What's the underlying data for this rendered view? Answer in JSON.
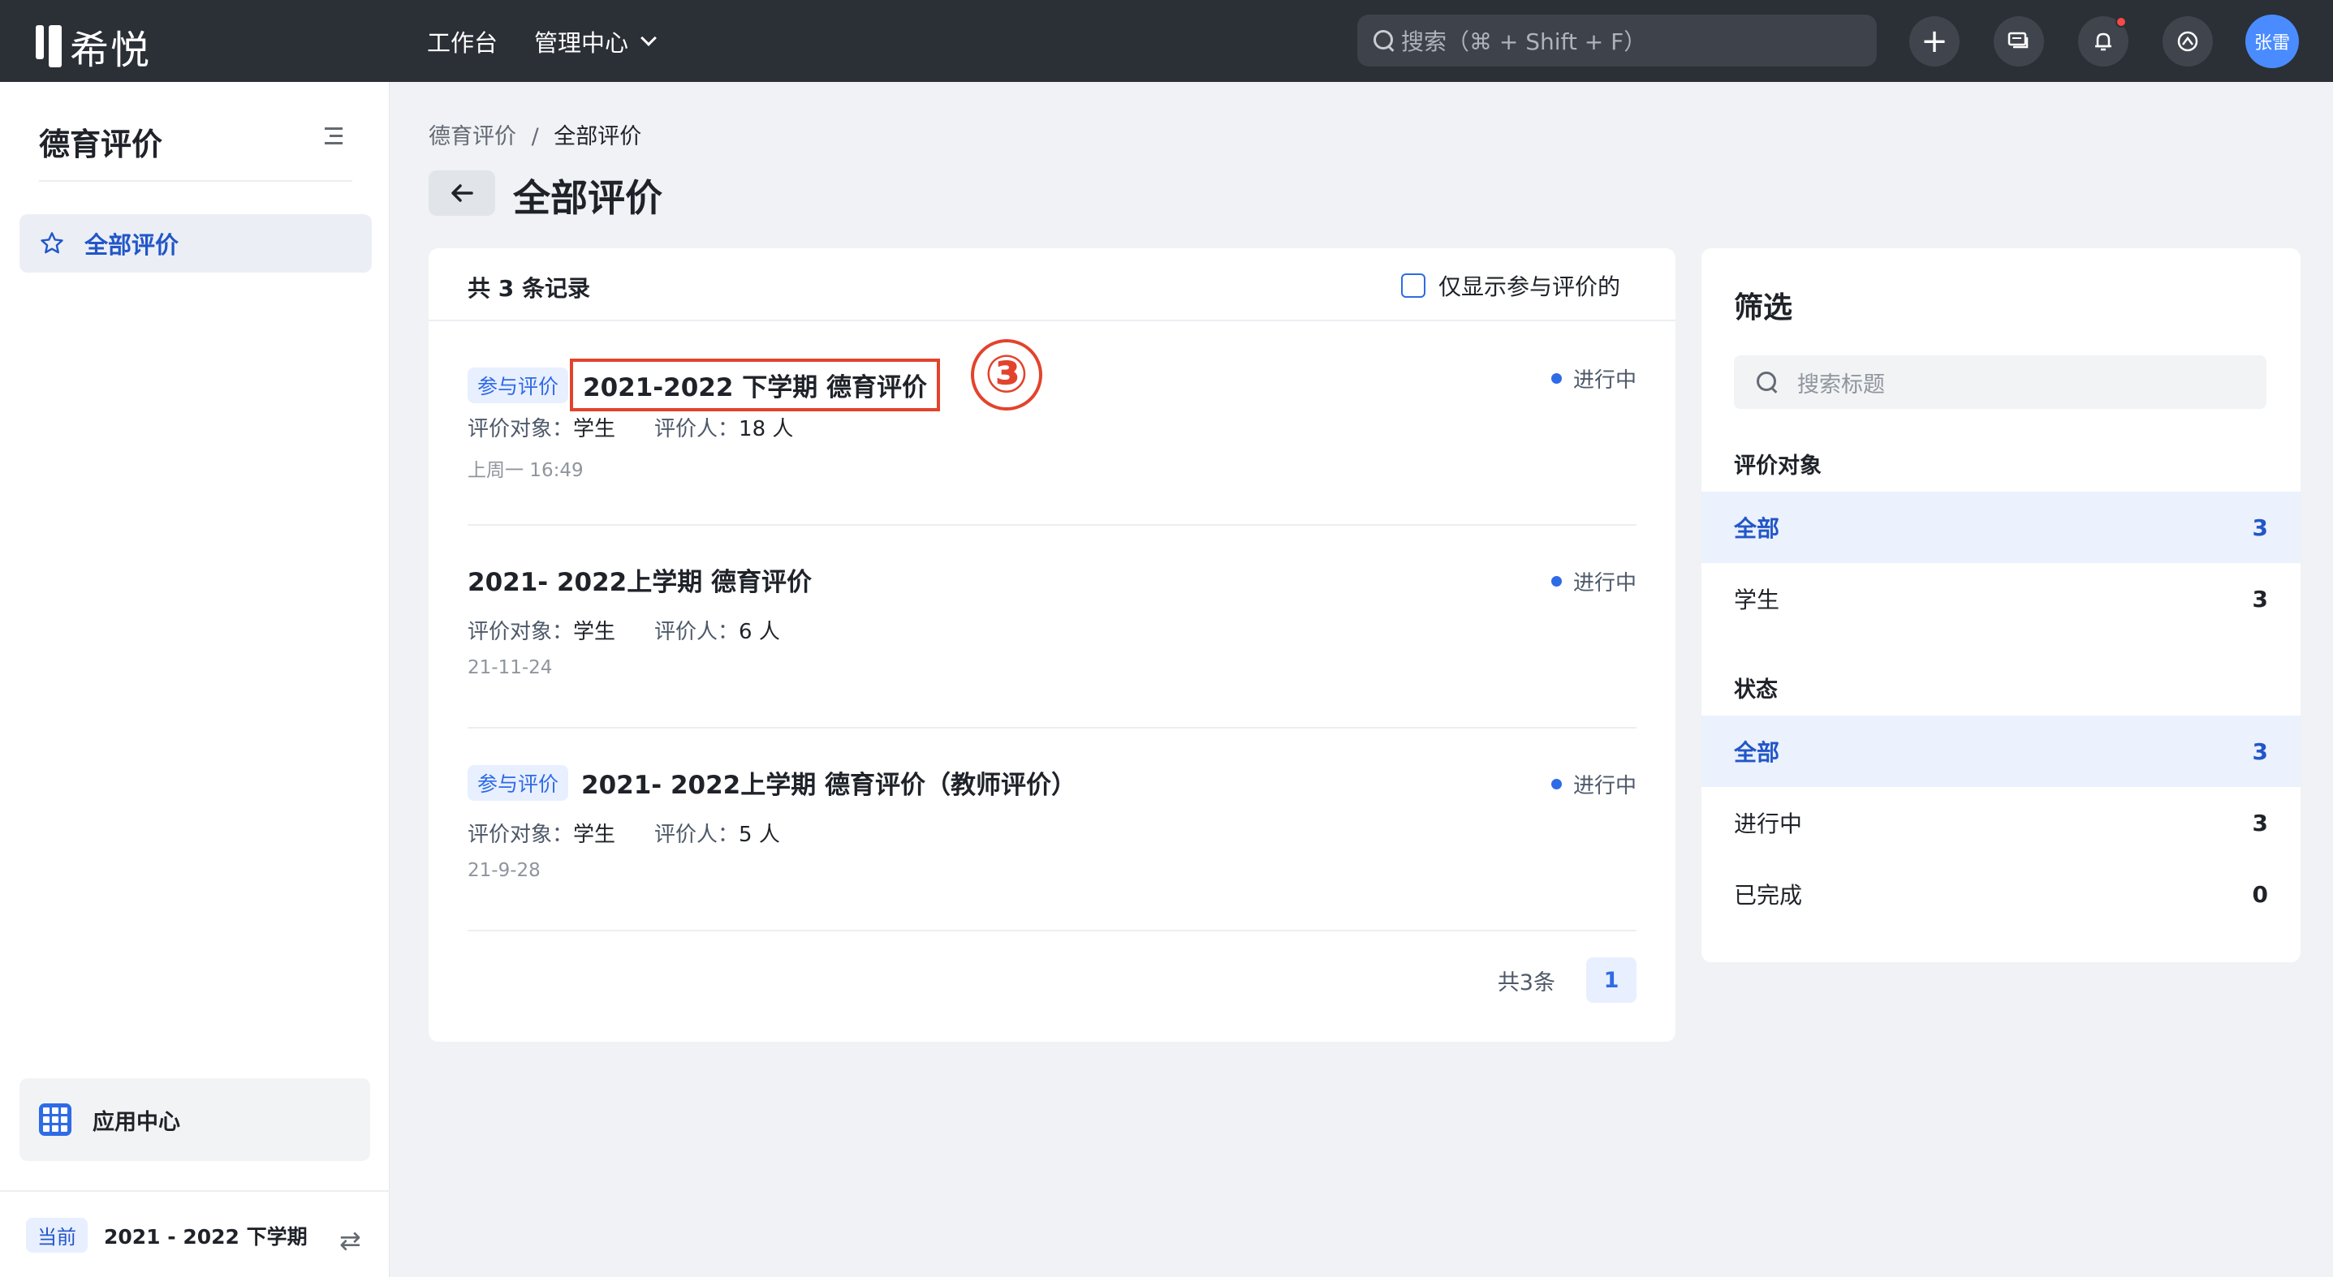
{
  "topbar": {
    "logo_text": "希悦",
    "nav_workbench": "工作台",
    "nav_admin": "管理中心",
    "search_placeholder": "搜索（⌘ + Shift + F）",
    "avatar_text": "张雷"
  },
  "sidebar": {
    "title": "德育评价",
    "active_item": "全部评价",
    "app_center": "应用中心",
    "term_badge": "当前",
    "term_text": "2021 - 2022 下学期"
  },
  "main": {
    "breadcrumb": [
      "德育评价",
      "/",
      "全部评价"
    ],
    "page_title": "全部评价",
    "total_label": "共 3 条记录",
    "only_mine_label": "仅显示参与评价的",
    "items": [
      {
        "tag": "参与评价",
        "title": "2021-2022 下学期 德育评价",
        "target_label": "评价对象：",
        "target": "学生",
        "evaluator_label": "评价人：",
        "evaluator": "18 人",
        "date": "上周一 16:49",
        "status": "进行中",
        "annotation": "③"
      },
      {
        "tag": "",
        "title": "2021- 2022上学期 德育评价",
        "target_label": "评价对象：",
        "target": "学生",
        "evaluator_label": "评价人：",
        "evaluator": "6 人",
        "date": "21-11-24",
        "status": "进行中"
      },
      {
        "tag": "参与评价",
        "title": "2021- 2022上学期 德育评价（教师评价）",
        "target_label": "评价对象：",
        "target": "学生",
        "evaluator_label": "评价人：",
        "evaluator": "5 人",
        "date": "21-9-28",
        "status": "进行中"
      }
    ],
    "pager_count": "共3条",
    "pager_current": "1"
  },
  "filter": {
    "title": "筛选",
    "search_placeholder": "搜索标题",
    "target_group": "评价对象",
    "target_options": [
      {
        "label": "全部",
        "count": "3"
      },
      {
        "label": "学生",
        "count": "3"
      }
    ],
    "status_group": "状态",
    "status_options": [
      {
        "label": "全部",
        "count": "3"
      },
      {
        "label": "进行中",
        "count": "3"
      },
      {
        "label": "已完成",
        "count": "0"
      }
    ]
  },
  "colors": {
    "topbar": "#2b2f36",
    "accent": "#2e6be6",
    "annotation": "#e3432c"
  }
}
